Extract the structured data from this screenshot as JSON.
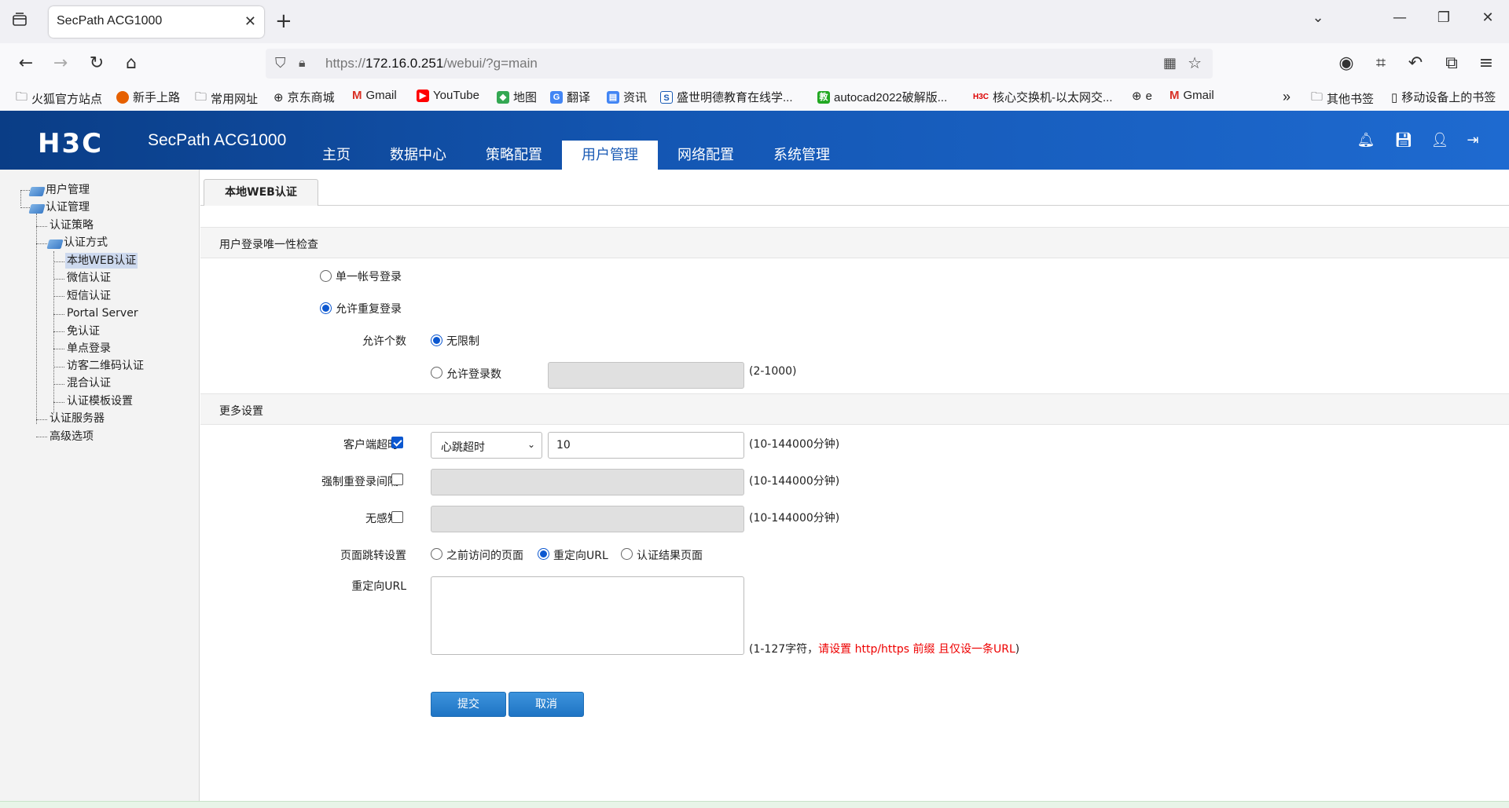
{
  "browser": {
    "tab_title": "SecPath ACG1000",
    "url_prefix": "https://",
    "url_host": "172.16.0.251",
    "url_path": "/webui/?g=main",
    "bookmarks": [
      {
        "label": "火狐官方站点",
        "icon": "folder-icon"
      },
      {
        "label": "新手上路",
        "icon": "firefox-icon"
      },
      {
        "label": "常用网址",
        "icon": "folder-icon"
      },
      {
        "label": "京东商城",
        "icon": "globe-icon"
      },
      {
        "label": "Gmail",
        "icon": "gmail-icon"
      },
      {
        "label": "YouTube",
        "icon": "youtube-icon"
      },
      {
        "label": "地图",
        "icon": "maps-icon"
      },
      {
        "label": "翻译",
        "icon": "translate-icon"
      },
      {
        "label": "资讯",
        "icon": "news-icon"
      },
      {
        "label": "盛世明德教育在线学...",
        "icon": "s-icon"
      },
      {
        "label": "autocad2022破解版...",
        "icon": "jiao-icon"
      },
      {
        "label": "核心交换机-以太网交...",
        "icon": "h3c-icon"
      },
      {
        "label": "e",
        "icon": "globe-icon"
      },
      {
        "label": "Gmail",
        "icon": "gmail-icon"
      }
    ],
    "other_bookmarks": "其他书签",
    "mobile_bookmarks": "移动设备上的书签"
  },
  "header": {
    "logo": "H3C",
    "product": "SecPath ACG1000",
    "nav": [
      "主页",
      "数据中心",
      "策略配置",
      "用户管理",
      "网络配置",
      "系统管理"
    ],
    "active_nav": "用户管理"
  },
  "sidebar": {
    "nodes": {
      "user_mgmt": "用户管理",
      "auth_mgmt": "认证管理",
      "auth_policy": "认证策略",
      "auth_method": "认证方式",
      "local_web": "本地WEB认证",
      "wechat": "微信认证",
      "sms": "短信认证",
      "portal": "Portal Server",
      "exempt": "免认证",
      "sso": "单点登录",
      "qr": "访客二维码认证",
      "mixed": "混合认证",
      "template": "认证模板设置",
      "server": "认证服务器",
      "advanced": "高级选项"
    }
  },
  "content": {
    "subtab": "本地WEB认证",
    "section1": "用户登录唯一性检查",
    "single_login": "单一帐号登录",
    "allow_repeat": "允许重复登录",
    "allow_count_label": "允许个数",
    "unlimited": "无限制",
    "allow_login_num": "允许登录数",
    "allow_login_range": "(2-1000)",
    "section2": "更多设置",
    "client_timeout_label": "客户端超时",
    "timeout_type": "心跳超时",
    "timeout_value": "10",
    "minutes_range": "(10-144000分钟)",
    "force_relogin_label": "强制重登录间隔",
    "seamless_label": "无感知",
    "redirect_settings_label": "页面跳转设置",
    "redirect_options": [
      "之前访问的页面",
      "重定向URL",
      "认证结果页面"
    ],
    "redirect_url_label": "重定向URL",
    "url_hint_prefix": "(1-127字符，",
    "url_hint_red": "请设置 http/https 前缀 且仅设一条URL",
    "url_hint_suffix": ")",
    "submit": "提交",
    "cancel": "取消"
  },
  "state": {
    "single_login": false,
    "allow_repeat": true,
    "unlimited": true,
    "client_timeout_checked": true,
    "force_relogin_checked": false,
    "seamless_checked": false,
    "redirect_selected": "重定向URL"
  },
  "colors": {
    "header_blue": "#1457b4",
    "accent": "#0b57d0",
    "hint_red": "#e00000"
  }
}
